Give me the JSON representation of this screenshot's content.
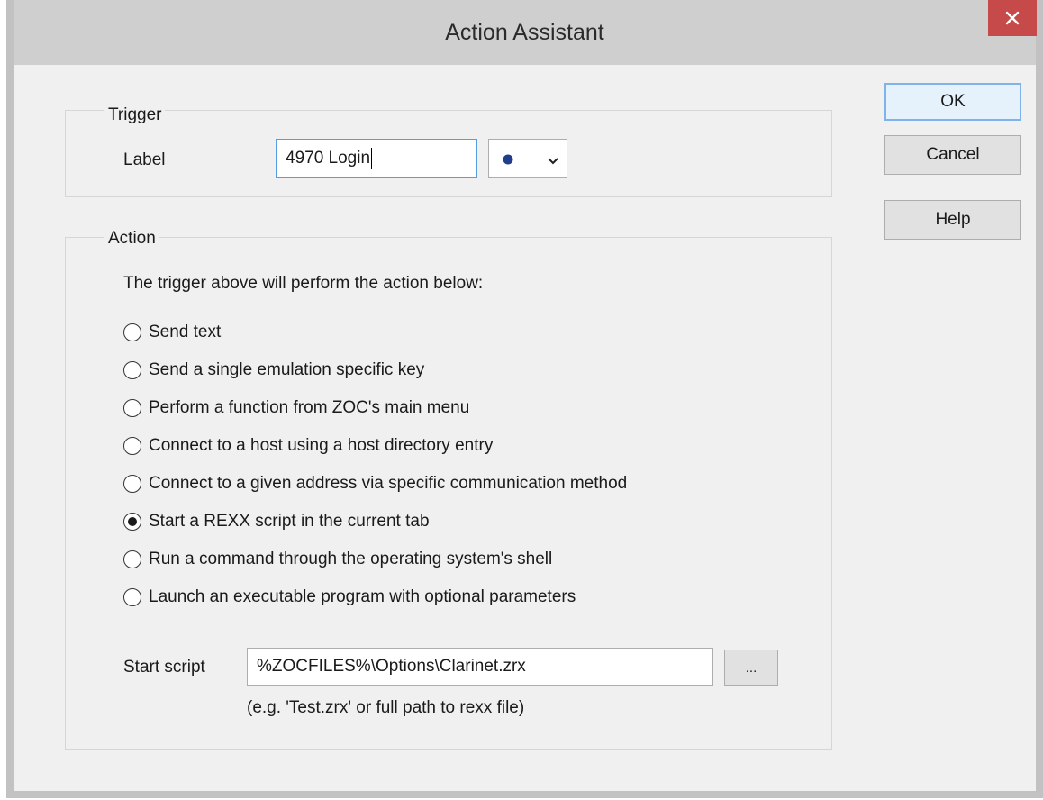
{
  "window": {
    "title": "Action Assistant"
  },
  "trigger": {
    "group_title": "Trigger",
    "label_caption": "Label",
    "label_value": "4970 Login",
    "color_dot": "#1f3f8a"
  },
  "action": {
    "group_title": "Action",
    "intro": "The trigger above will perform the action below:",
    "options": [
      {
        "label": "Send text",
        "checked": false
      },
      {
        "label": "Send a single emulation specific key",
        "checked": false
      },
      {
        "label": "Perform a function from ZOC's main menu",
        "checked": false
      },
      {
        "label": "Connect to a host using a host directory entry",
        "checked": false
      },
      {
        "label": "Connect to a given address via specific communication method",
        "checked": false
      },
      {
        "label": "Start a REXX script in the current tab",
        "checked": true
      },
      {
        "label": "Run a command through the operating system's shell",
        "checked": false
      },
      {
        "label": "Launch an executable program with optional parameters",
        "checked": false
      }
    ],
    "script_caption": "Start script",
    "script_value": "%ZOCFILES%\\Options\\Clarinet.zrx",
    "browse_label": "...",
    "hint": "(e.g. 'Test.zrx' or full path to rexx file)"
  },
  "buttons": {
    "ok": "OK",
    "cancel": "Cancel",
    "help": "Help"
  },
  "colors": {
    "close_button": "#c74a4a",
    "focus_border": "#569de5"
  }
}
